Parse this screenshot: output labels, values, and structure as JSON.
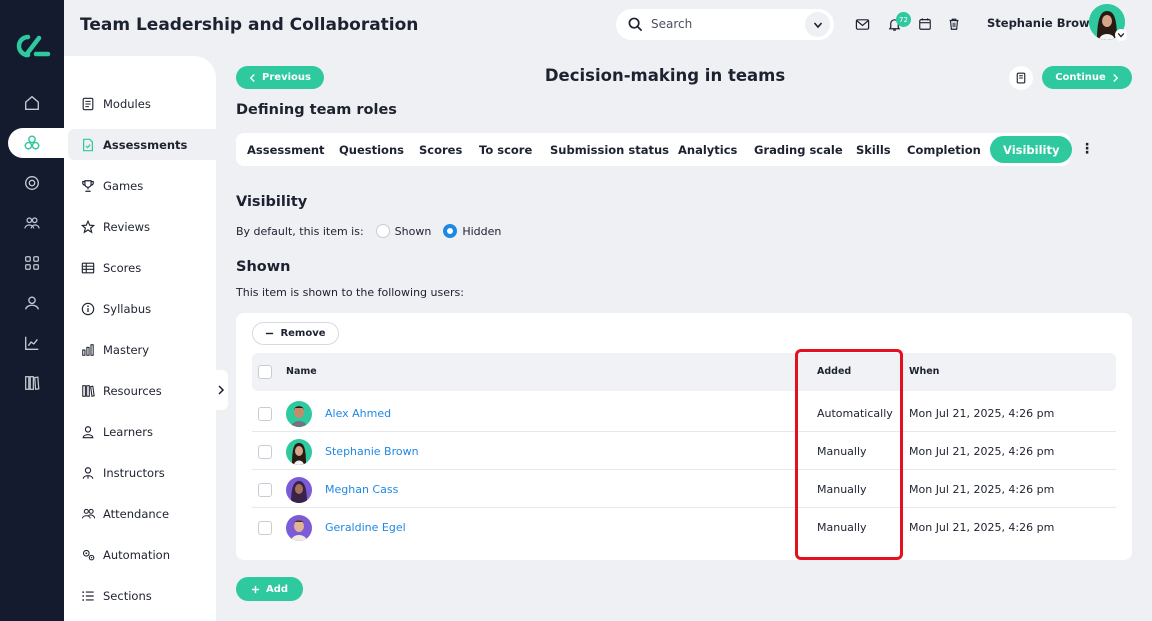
{
  "header": {
    "app_title": "Team Leadership and Collaboration",
    "search_placeholder": "Search",
    "notification_count": "72",
    "user_name": "Stephanie Brown"
  },
  "sidebar": {
    "items": [
      {
        "label": "Modules",
        "icon": "modules-icon"
      },
      {
        "label": "Assessments",
        "icon": "assessments-icon",
        "active": true
      },
      {
        "label": "Games",
        "icon": "trophy-icon"
      },
      {
        "label": "Reviews",
        "icon": "star-icon"
      },
      {
        "label": "Scores",
        "icon": "table-icon"
      },
      {
        "label": "Syllabus",
        "icon": "info-icon"
      },
      {
        "label": "Mastery",
        "icon": "bars-icon"
      },
      {
        "label": "Resources",
        "icon": "books-icon"
      },
      {
        "label": "Learners",
        "icon": "person-icon"
      },
      {
        "label": "Instructors",
        "icon": "instructor-icon"
      },
      {
        "label": "Attendance",
        "icon": "group-icon"
      },
      {
        "label": "Automation",
        "icon": "gears-icon"
      },
      {
        "label": "Sections",
        "icon": "list-icon"
      }
    ]
  },
  "page": {
    "previous_label": "Previous",
    "title": "Decision-making in teams",
    "continue_label": "Continue",
    "subtitle": "Defining team roles"
  },
  "tabs": [
    {
      "label": "Assessment"
    },
    {
      "label": "Questions"
    },
    {
      "label": "Scores"
    },
    {
      "label": "To score"
    },
    {
      "label": "Submission status"
    },
    {
      "label": "Analytics"
    },
    {
      "label": "Grading scale"
    },
    {
      "label": "Skills"
    },
    {
      "label": "Completion"
    },
    {
      "label": "Visibility",
      "active": true
    }
  ],
  "visibility": {
    "heading": "Visibility",
    "default_label": "By default, this item is:",
    "option_shown": "Shown",
    "option_hidden": "Hidden",
    "selected": "Hidden"
  },
  "shown": {
    "heading": "Shown",
    "description": "This item is shown to the following users:",
    "remove_label": "Remove",
    "columns": {
      "name": "Name",
      "added": "Added",
      "when": "When"
    },
    "rows": [
      {
        "name": "Alex Ahmed",
        "added": "Automatically",
        "when": "Mon Jul 21, 2025, 4:26 pm"
      },
      {
        "name": "Stephanie Brown",
        "added": "Manually",
        "when": "Mon Jul 21, 2025, 4:26 pm"
      },
      {
        "name": "Meghan Cass",
        "added": "Manually",
        "when": "Mon Jul 21, 2025, 4:26 pm"
      },
      {
        "name": "Geraldine Egel",
        "added": "Manually",
        "when": "Mon Jul 21, 2025, 4:26 pm"
      }
    ],
    "add_label": "Add"
  },
  "colors": {
    "accent": "#2ec99e",
    "link": "#1e88e5",
    "rail": "#141b2e",
    "highlight": "#e5101e"
  }
}
